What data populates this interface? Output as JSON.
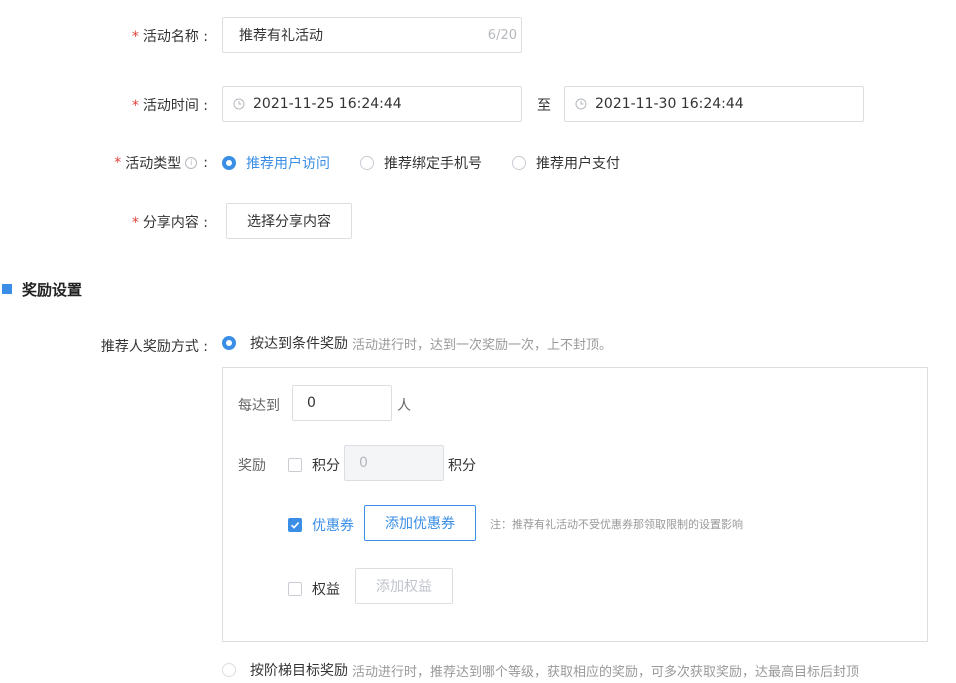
{
  "form": {
    "name": {
      "label": "活动名称 :",
      "value": "推荐有礼活动",
      "counter": "6/20"
    },
    "time": {
      "label": "活动时间 :",
      "start": "2021-11-25 16:24:44",
      "to": "至",
      "end": "2021-11-30 16:24:44"
    },
    "type": {
      "label": "活动类型",
      "colon": ":",
      "options": [
        "推荐用户访问",
        "推荐绑定手机号",
        "推荐用户支付"
      ],
      "selected": "推荐用户访问"
    },
    "share": {
      "label": "分享内容 :",
      "button": "选择分享内容"
    }
  },
  "reward_section": {
    "title": "奖励设置",
    "mode_label": "推荐人奖励方式 :",
    "option1": {
      "title": "按达到条件奖励",
      "desc": "活动进行时，达到一次奖励一次，上不封顶。"
    },
    "panel": {
      "every_label": "每达到",
      "every_value": "0",
      "every_unit": "人",
      "reward_label": "奖励",
      "points_label": "积分",
      "points_value": "0",
      "points_unit": "积分",
      "coupon_label": "优惠券",
      "coupon_button": "添加优惠券",
      "coupon_note": "注：推荐有礼活动不受优惠券那领取限制的设置影响",
      "rights_label": "权益",
      "rights_button": "添加权益"
    },
    "option2": {
      "title": "按阶梯目标奖励",
      "desc": "活动进行时，推荐达到哪个等级，获取相应的奖励，可多次获取奖励，达最高目标后封顶"
    }
  },
  "colors": {
    "accent": "#3a8ee6",
    "required": "#e0403a",
    "border": "#dcdee2"
  }
}
